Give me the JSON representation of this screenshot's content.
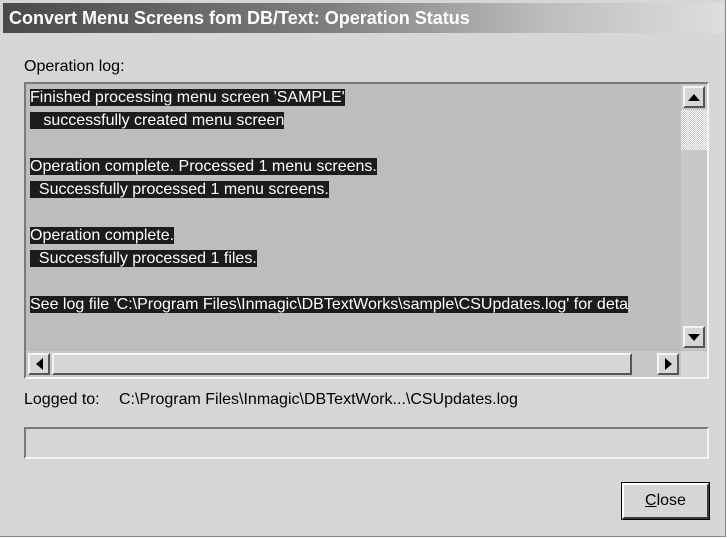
{
  "window": {
    "title": "Convert Menu Screens fom DB/Text: Operation Status"
  },
  "log": {
    "label": "Operation log:",
    "lines": [
      {
        "text": "Finished processing menu screen 'SAMPLE'",
        "highlighted": true
      },
      {
        "text": "   successfully created menu screen",
        "highlighted": true
      },
      {
        "text": "",
        "highlighted": false
      },
      {
        "text": "Operation complete. Processed 1 menu screens.",
        "highlighted": true
      },
      {
        "text": "  Successfully processed 1 menu screens.",
        "highlighted": true
      },
      {
        "text": "",
        "highlighted": false
      },
      {
        "text": "Operation complete.",
        "highlighted": true
      },
      {
        "text": "  Successfully processed 1 files.",
        "highlighted": true
      },
      {
        "text": "",
        "highlighted": false
      },
      {
        "text": "See log file 'C:\\Program Files\\Inmagic\\DBTextWorks\\sample\\CSUpdates.log' for deta",
        "highlighted": true
      }
    ]
  },
  "logged_to": {
    "label": "Logged to:",
    "path": "C:\\Program Files\\Inmagic\\DBTextWork...\\CSUpdates.log"
  },
  "progress": {
    "value": 0
  },
  "buttons": {
    "close_accel": "C",
    "close_rest": "lose"
  },
  "icons": {
    "scroll_up": "arrow-up-icon",
    "scroll_down": "arrow-down-icon",
    "scroll_left": "arrow-left-icon",
    "scroll_right": "arrow-right-icon"
  },
  "colors": {
    "title_gradient_start": "#4a4a4a",
    "window_background": "#d6d6d6",
    "log_background": "#bdbdbd",
    "selection_background": "#1c1c1c"
  }
}
